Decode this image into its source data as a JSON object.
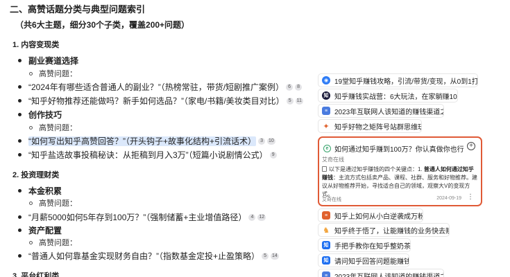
{
  "doc": {
    "section_title": "二、高赞话题分类与典型问题索引",
    "intro": "（共6大主题，细分30个子类，覆盖200+问题）",
    "s1_title": "1. 内容变现类",
    "s1_a_label": "副业赛道选择",
    "s1_a_sub": "高赞问题：",
    "s1_a_q1": "“2024年有哪些适合普通人的副业？”（热榜常驻，带货/短剧推广案例）",
    "s1_a_q1_refs": [
      "6",
      "8"
    ],
    "s1_a_q2": "“知乎好物推荐还能做吗？新手如何选品？”（家电/书籍/美妆类目对比）",
    "s1_a_q2_refs": [
      "5",
      "11"
    ],
    "s1_b_label": "创作技巧",
    "s1_b_sub": "高赞问题：",
    "s1_b_q1": "“如何写出知乎高赞回答？”（开头钩子+故事化结构+引流话术）",
    "s1_b_q1_refs": [
      "3",
      "10"
    ],
    "s1_b_q2": "“知乎盐选故事投稿秘诀：从拒稿到月入3万”（短篇小说剧情公式）",
    "s1_b_q2_refs": [
      "9"
    ],
    "s2_title": "2. 投资理财类",
    "s2_a_label": "本金积累",
    "s2_a_sub": "高赞问题：",
    "s2_a_q1": "“月薪5000如何5年存到100万？”（强制储蓄+主业增值路径）",
    "s2_a_q1_refs": [
      "4",
      "12"
    ],
    "s2_b_label": "资产配置",
    "s2_b_sub": "高赞问题：",
    "s2_b_q1": "“普通人如何靠基金实现财务自由？”（指数基金定投+止盈策略）",
    "s2_b_q1_refs": [
      "5",
      "14"
    ],
    "s3_title": "3. 平台红利类"
  },
  "sources": [
    {
      "title": "19堂知乎赚钱攻略，引流/带货/变现，从0到1打造副...",
      "icon": "blue-circle-icon",
      "color": "#2e7cf6"
    },
    {
      "title": "知乎赚钱实战营：6大玩法，在家躺赚10000",
      "icon": "zhihu-circle-icon",
      "color": "#1a1a3a"
    },
    {
      "title": "2023年互联网人该知道的赚钱渠道之知乎",
      "icon": "document-icon",
      "color": "#4a7bdf"
    },
    {
      "title": "知乎好物之矩阵号站群思维玩法",
      "icon": "fox-icon",
      "color": "#e0612d"
    }
  ],
  "card": {
    "title": "如何通过知乎赚到100万？你认真做你也行",
    "site": "艾奇在线",
    "body_prefix": "以下是通过知乎赚钱的四个关键点：1. ",
    "body_bold": "普通人如何通过知乎赚钱",
    "body_rest": "：主流方式包括卖产品、课程、社群、服务和好物推荐。建议从好物推荐开始，寻找适合自己的领域，观察大V的变现方式。",
    "footer_source": "艾奇在线",
    "date": "2024-09-19",
    "more": "⋮",
    "plus": "+"
  },
  "sources2": [
    {
      "title": "知乎上如何从小白逆袭成万粉大V",
      "icon": "document-icon",
      "color": "#e0612d"
    },
    {
      "title": "知乎终于悟了，让能赚钱的业务快去赚钱",
      "icon": "colorful-icon",
      "color": "#f2a33a"
    },
    {
      "title": "手把手教你在知乎整奶茶喝",
      "icon": "zhihu-icon",
      "color": "#1e6ff1"
    },
    {
      "title": "请问知乎回答问题能赚钱吗?",
      "icon": "zhihu-icon",
      "color": "#1e6ff1"
    },
    {
      "title": "2023年互联网人该知道的赚钱渠道之知乎",
      "icon": "document-icon",
      "color": "#4a7bdf"
    }
  ],
  "colors": {
    "accent": "#e05a36",
    "highlight": "#dbe8fb"
  }
}
